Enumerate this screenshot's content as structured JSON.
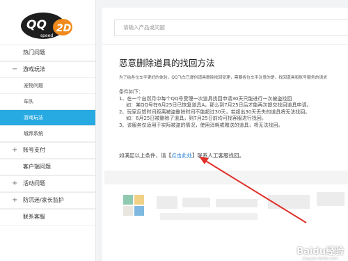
{
  "logo": {
    "text": "QQ飞车 2D"
  },
  "sidebar": {
    "items": [
      {
        "label": "热门问题",
        "sign": "",
        "type": "top"
      },
      {
        "label": "游戏玩法",
        "sign": "−",
        "type": "top"
      },
      {
        "label": "宠物问题",
        "sign": "",
        "type": "sub"
      },
      {
        "label": "车队",
        "sign": "",
        "type": "sub"
      },
      {
        "label": "游戏玩法",
        "sign": "",
        "type": "sub active"
      },
      {
        "label": "城邦系统",
        "sign": "",
        "type": "sub"
      },
      {
        "label": "账号支付",
        "sign": "+",
        "type": "top"
      },
      {
        "label": "客户端问题",
        "sign": "",
        "type": "top"
      },
      {
        "label": "活动问题",
        "sign": "+",
        "type": "top"
      },
      {
        "label": "防沉迷/家长监护",
        "sign": "+",
        "type": "top"
      },
      {
        "label": "联系客服",
        "sign": "",
        "type": "top"
      }
    ]
  },
  "search": {
    "placeholder": "请输入产品或问题"
  },
  "article": {
    "title": "恶意删除道具的找回方法",
    "intro": "为了给各位车手更好的体验，QQ飞车已提供道具删除找回受理，需要各位车手注意的是，找回道具和账号服务的请求",
    "conditions": [
      "条件如下：",
      "1、在一个自然月中每个QQ号受理一次道具找回申请30天只能进行一次被盗找回",
      "如：某QQ号在6月25日已恢复道具A，那么到7月25日后才能再次提交找回道具申请。",
      "2、玩家反馈时间距离被盗删除时间不能超过30天，若超出30天丢失的道具将无法找回。",
      "如：6月25日被删除了道具，则7月25日前均可找客服进行找回。",
      "3、该服务仅适用于实际被盗的情况，使用消耗或赠送的道具，将无法找回。"
    ],
    "footer_prefix": "如满足以上条件，请【",
    "footer_link": "点击此处",
    "footer_suffix": "】联系人工客服找回。"
  },
  "watermark": {
    "main": "Baidu经验",
    "sub": "jingyan.baidu.com"
  },
  "colors": {
    "accent": "#27a9e1",
    "link": "#2a84d3",
    "arrow": "#e0302a"
  }
}
